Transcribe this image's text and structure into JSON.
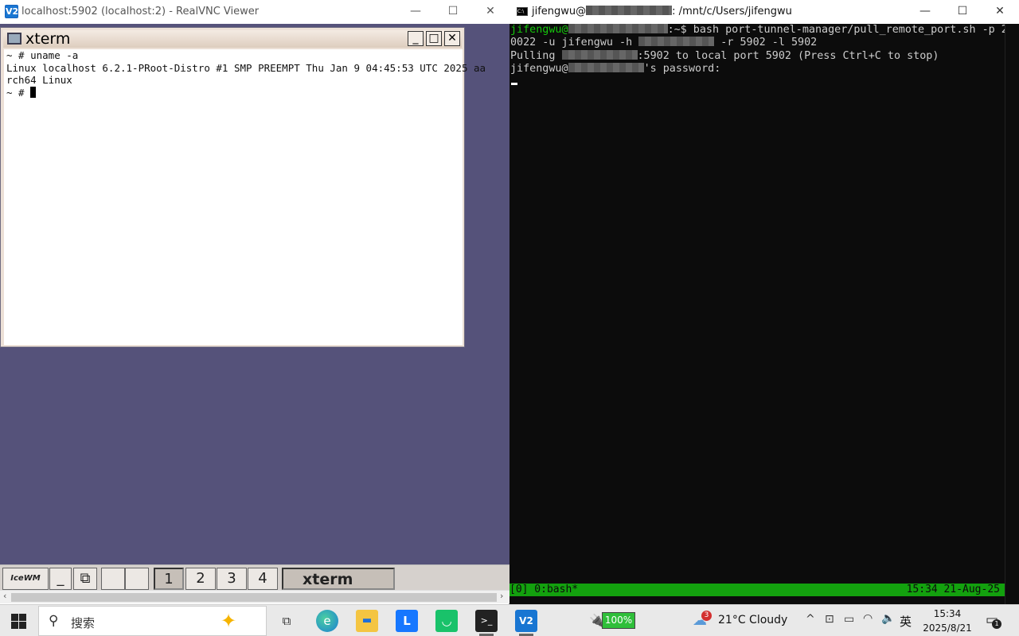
{
  "vnc": {
    "title": "localhost:5902 (localhost:2) - RealVNC Viewer",
    "logo": "V2",
    "xterm": {
      "title": "xterm",
      "lines": [
        "~ # uname -a",
        "Linux localhost 6.2.1-PRoot-Distro #1 SMP PREEMPT Thu Jan 9 04:45:53 UTC 2025 aa",
        "rch64 Linux"
      ],
      "prompt": "~ # "
    },
    "taskbar": {
      "logo": "IceWM",
      "desktops": [
        "1",
        "2",
        "3",
        "4"
      ],
      "window_label": "xterm"
    }
  },
  "terminal": {
    "title_prefix": "jifengwu@",
    "title_suffix": ": /mnt/c/Users/jifengwu",
    "line1_user": "jifengwu@",
    "line1_cmd": ":~$ bash port-tunnel-manager/pull_remote_port.sh -p 2",
    "line2_a": "0022 -u jifengwu -h ",
    "line2_b": " -r 5902 -l 5902",
    "line3_a": "Pulling ",
    "line3_b": ":5902 to local port 5902 (Press Ctrl+C to stop)",
    "line4_a": "jifengwu@",
    "line4_b": "'s password:",
    "tmux_left": "[0] 0:bash*",
    "tmux_right": "15:34 21-Aug-25"
  },
  "win_taskbar": {
    "search_placeholder": "搜索",
    "battery": "100%",
    "weather_badge": "3",
    "weather": "21°C  Cloudy",
    "ime": "英",
    "time": "15:34",
    "date": "2025/8/21",
    "notify_count": "1"
  }
}
